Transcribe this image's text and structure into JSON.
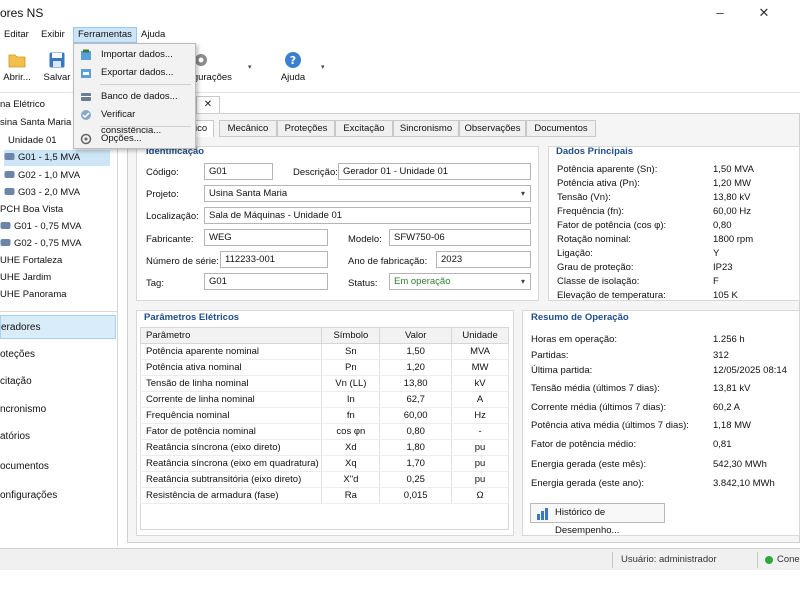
{
  "window": {
    "title": "ores NS",
    "minimize": "–",
    "close": "✕"
  },
  "menu": [
    "Editar",
    "Exibir",
    "Ferramentas",
    "Ajuda"
  ],
  "toolbar": {
    "open_label": "Abrir...",
    "save_label": "Salvar",
    "settings_label": "figurações",
    "help_label": "Ajuda"
  },
  "tools_menu": {
    "items": [
      "Importar dados...",
      "Exportar dados...",
      "Banco de dados...",
      "Verificar consistência...",
      "Opções..."
    ]
  },
  "tree": {
    "root": "na Elétrico",
    "plant1": "sina Santa Maria",
    "unit1": "Unidade 01",
    "gens1": [
      "G01 - 1,5 MVA",
      "G02 - 1,0 MVA",
      "G03 - 2,0 MVA"
    ],
    "plant2": "PCH Boa Vista",
    "gens2": [
      "G01 - 0,75 MVA",
      "G02 - 0,75 MVA"
    ],
    "plant3": "UHE Fortaleza",
    "plant4": "UHE Jardim",
    "plant5": "UHE Panorama"
  },
  "nav": [
    "eradores",
    "oteções",
    "citação",
    "ncronismo",
    "atórios",
    "ocumentos",
    "onfigurações"
  ],
  "doc_tab_close": "✕",
  "tabs": [
    "rico",
    "Mecânico",
    "Proteções",
    "Excitação",
    "Sincronismo",
    "Observações",
    "Documentos"
  ],
  "identification": {
    "title": "Identificação",
    "codigo_label": "Código:",
    "codigo": "G01",
    "descricao_label": "Descrição:",
    "descricao": "Gerador 01 - Unidade 01",
    "projeto_label": "Projeto:",
    "projeto": "Usina Santa Maria",
    "localizacao_label": "Localização:",
    "localizacao": "Sala de Máquinas - Unidade 01",
    "fabricante_label": "Fabricante:",
    "fabricante": "WEG",
    "modelo_label": "Modelo:",
    "modelo": "SFW750-06",
    "serie_label": "Número de série:",
    "serie": "112233-001",
    "ano_label": "Ano de fabricação:",
    "ano": "2023",
    "tag_label": "Tag:",
    "tag": "G01",
    "status_label": "Status:",
    "status": "Em operação",
    "status_color": "#2e7d32"
  },
  "main_data": {
    "title": "Dados Principais",
    "rows": [
      {
        "label": "Potência aparente (Sn):",
        "value": "1,50  MVA"
      },
      {
        "label": "Potência ativa (Pn):",
        "value": "1,20  MW"
      },
      {
        "label": "Tensão (Vn):",
        "value": "13,80 kV"
      },
      {
        "label": "Frequência (fn):",
        "value": "60,00 Hz"
      },
      {
        "label": "Fator de potência (cos φ):",
        "value": "0,80"
      },
      {
        "label": "Rotação nominal:",
        "value": "1800 rpm"
      },
      {
        "label": "Ligação:",
        "value": "Y"
      },
      {
        "label": "Grau de proteção:",
        "value": "IP23"
      },
      {
        "label": "Classe de isolação:",
        "value": "F"
      },
      {
        "label": "Elevação de temperatura:",
        "value": "105 K"
      }
    ]
  },
  "electrical": {
    "title": "Parâmetros Elétricos",
    "headers": [
      "Parâmetro",
      "Símbolo",
      "Valor",
      "Unidade"
    ],
    "rows": [
      [
        "Potência aparente nominal",
        "Sn",
        "1,50",
        "MVA"
      ],
      [
        "Potência ativa nominal",
        "Pn",
        "1,20",
        "MW"
      ],
      [
        "Tensão de linha nominal",
        "Vn (LL)",
        "13,80",
        "kV"
      ],
      [
        "Corrente de linha nominal",
        "In",
        "62,7",
        "A"
      ],
      [
        "Frequência nominal",
        "fn",
        "60,00",
        "Hz"
      ],
      [
        "Fator de potência nominal",
        "cos φn",
        "0,80",
        "-"
      ],
      [
        "Reatância síncrona (eixo direto)",
        "Xd",
        "1,80",
        "pu"
      ],
      [
        "Reatância síncrona (eixo em quadratura)",
        "Xq",
        "1,70",
        "pu"
      ],
      [
        "Reatância subtransitória (eixo direto)",
        "X\"d",
        "0,25",
        "pu"
      ],
      [
        "Resistência de armadura (fase)",
        "Ra",
        "0,015",
        "Ω"
      ]
    ]
  },
  "operation": {
    "title": "Resumo de Operação",
    "rows": [
      {
        "label": "Horas em operação:",
        "value": "1.256 h"
      },
      {
        "label": "Partidas:",
        "value": "312"
      },
      {
        "label": "Última partida:",
        "value": "12/05/2025  08:14"
      },
      {
        "label": "Tensão média (últimos 7 dias):",
        "value": "13,81 kV"
      },
      {
        "label": "Corrente média (últimos 7 dias):",
        "value": "60,2 A"
      },
      {
        "label": "Potência ativa média (últimos 7 dias):",
        "value": "1,18 MW"
      },
      {
        "label": "Fator de potência médio:",
        "value": "0,81"
      },
      {
        "label": "Energia gerada (este mês):",
        "value": "542,30  MWh"
      },
      {
        "label": "Energia gerada (este ano):",
        "value": "3.842,10  MWh"
      }
    ],
    "history_button": "Histórico de Desempenho..."
  },
  "status": {
    "user": "Usuário: administrador",
    "connection": "Conec",
    "connection_color": "#2eaa3c"
  }
}
